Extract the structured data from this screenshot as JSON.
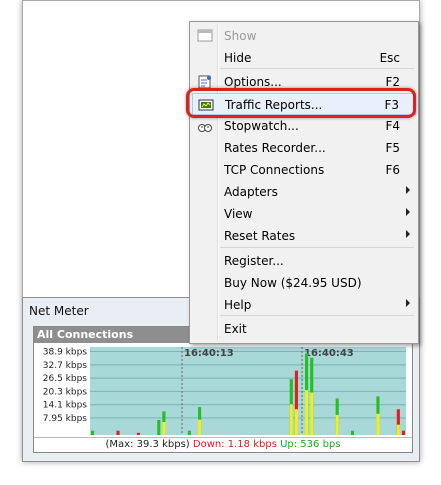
{
  "menu": {
    "items": [
      {
        "label": "Show",
        "key": "",
        "icon": "window-icon",
        "disabled": true
      },
      {
        "label": "Hide",
        "key": "Esc"
      },
      {
        "label": "Options...",
        "key": "F2",
        "icon": "options-icon"
      },
      {
        "label": "Traffic Reports...",
        "key": "F3",
        "icon": "report-icon",
        "highlighted": true
      },
      {
        "label": "Stopwatch...",
        "key": "F4",
        "icon": "stopwatch-icon"
      },
      {
        "label": "Rates Recorder...",
        "key": "F5"
      },
      {
        "label": "TCP Connections",
        "key": "F6"
      },
      {
        "label": "Adapters",
        "submenu": true
      },
      {
        "label": "View",
        "submenu": true
      },
      {
        "label": "Reset Rates",
        "submenu": true
      },
      {
        "label": "Register..."
      },
      {
        "label": "Buy Now ($24.95 USD)"
      },
      {
        "label": "Help",
        "submenu": true
      },
      {
        "label": "Exit"
      }
    ]
  },
  "net_meter": {
    "title": "Net Meter",
    "panel_title": "All Connections",
    "status": {
      "max": "(Max: 39.3 kbps)",
      "down": "Down: 1.18 kbps",
      "up": "Up: 536 bps"
    }
  },
  "chart_data": {
    "type": "bar",
    "y_ticks": [
      "38.9 kbps",
      "32.7 kbps",
      "26.5 kbps",
      "20.3 kbps",
      "14.1 kbps",
      "7.95 kbps"
    ],
    "time_labels": [
      "16:40:13",
      "16:40:43"
    ],
    "ylim": [
      0,
      41
    ],
    "grid": true,
    "colors": {
      "up": "#22c022",
      "down": "#e02020",
      "both": "#f0f020",
      "background": "#a8d8d8"
    },
    "series": [
      {
        "name": "Up",
        "values": [
          2,
          0,
          0,
          0,
          0,
          0,
          0,
          0,
          0,
          0,
          0,
          0,
          0,
          7,
          11,
          0,
          0,
          0,
          0,
          2,
          0,
          13,
          0,
          0,
          0,
          0,
          0,
          0,
          0,
          0,
          0,
          0,
          0,
          0,
          0,
          0,
          0,
          0,
          0,
          26,
          0,
          0,
          38,
          36,
          0,
          0,
          0,
          0,
          17,
          0,
          0,
          2,
          0,
          0,
          0,
          0,
          18,
          0,
          0,
          0,
          0,
          0
        ]
      },
      {
        "name": "Down",
        "values": [
          0,
          0,
          0,
          0,
          0,
          2,
          0,
          0,
          0,
          1,
          0,
          0,
          0,
          0,
          0,
          0,
          0,
          0,
          0,
          0,
          0,
          0,
          0,
          0,
          0,
          0,
          0,
          0,
          0,
          0,
          0,
          0,
          0,
          0,
          0,
          0,
          0,
          0,
          0,
          0,
          30,
          0,
          0,
          0,
          0,
          0,
          0,
          0,
          0,
          0,
          0,
          0,
          0,
          0,
          0,
          0,
          0,
          0,
          0,
          0,
          12,
          2
        ]
      }
    ]
  }
}
